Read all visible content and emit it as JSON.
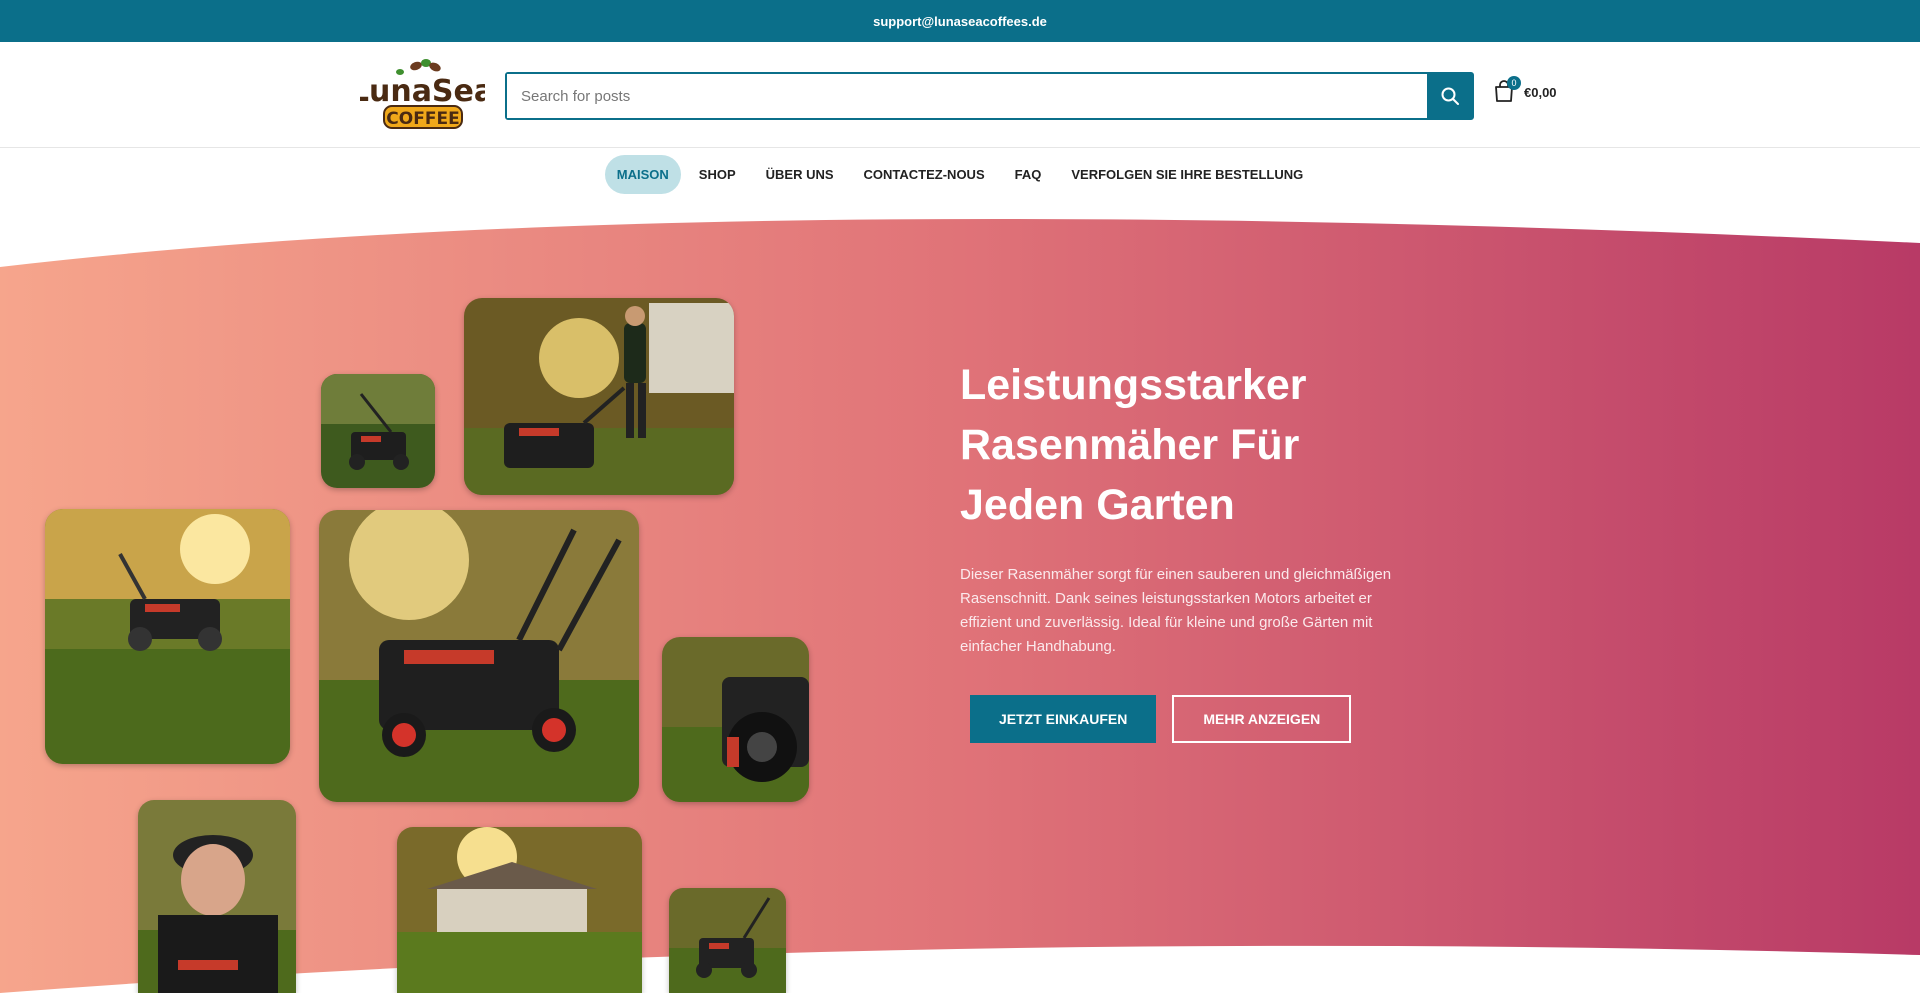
{
  "topbar": {
    "email": "support@lunaseacoffees.de"
  },
  "header": {
    "logo": {
      "line1": "LunaSea",
      "line2": "COFFEE"
    },
    "search": {
      "placeholder": "Search for posts",
      "icon": "search-icon"
    },
    "cart": {
      "icon": "shopping-bag-icon",
      "count": "0",
      "total": "€0,00"
    }
  },
  "nav": {
    "items": [
      {
        "label": "Maison",
        "active": true
      },
      {
        "label": "Shop"
      },
      {
        "label": "Über uns"
      },
      {
        "label": "Contactez-nous"
      },
      {
        "label": "FAQ"
      },
      {
        "label": "Verfolgen Sie Ihre Bestellung"
      }
    ]
  },
  "hero": {
    "title": "Leistungsstarker Rasenmäher Für Jeden Garten",
    "description": "Dieser Rasenmäher sorgt für einen sauberen und gleichmäßigen Rasenschnitt. Dank seines leistungsstarken Motors arbeitet er effizient und zuverlässig. Ideal für kleine und große Gärten mit einfacher Handhabung.",
    "primary_button": "Jetzt einkaufen",
    "secondary_button": "Mehr anzeigen",
    "gradient": {
      "start": "#f6a58c",
      "middle": "#e07378",
      "end": "#b83a66"
    }
  },
  "colors": {
    "accent": "#0b6f8a",
    "nav_active_bg": "#bfe0e6"
  }
}
